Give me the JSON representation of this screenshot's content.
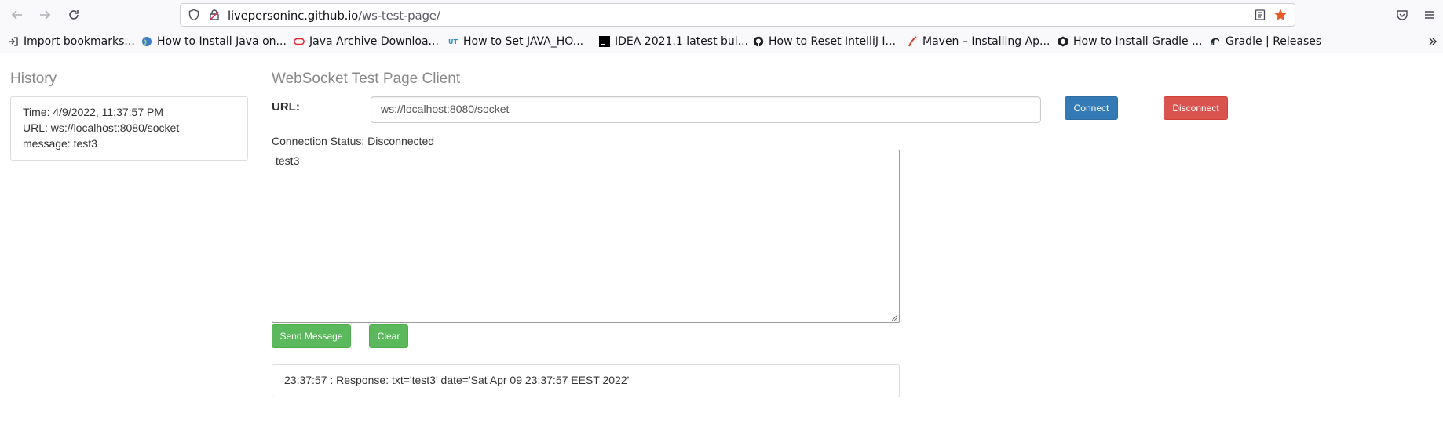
{
  "browser": {
    "url_host": "livepersoninc.github.io",
    "url_path": "/ws-test-page/",
    "bookmarks": [
      {
        "label": "Import bookmarks...",
        "icon": "import-icon"
      },
      {
        "label": "How to Install Java on...",
        "icon": "globe-icon"
      },
      {
        "label": "Java Archive Downloa...",
        "icon": "oracle-icon"
      },
      {
        "label": "How to Set JAVA_HO...",
        "icon": "ut-icon"
      },
      {
        "label": "IDEA 2021.1 latest bui...",
        "icon": "jetbrains-icon"
      },
      {
        "label": "How to Reset IntelliJ I...",
        "icon": "github-icon"
      },
      {
        "label": "Maven – Installing Ap...",
        "icon": "feather-icon"
      },
      {
        "label": "How to Install Gradle ...",
        "icon": "hexagon-icon"
      },
      {
        "label": "Gradle | Releases",
        "icon": "elephant-icon"
      }
    ]
  },
  "history": {
    "title": "History",
    "entry": {
      "time": "Time: 4/9/2022, 11:37:57 PM",
      "url": "URL: ws://localhost:8080/socket",
      "message": "message: test3"
    }
  },
  "client": {
    "title": "WebSocket Test Page Client",
    "url_label": "URL:",
    "url_value": "ws://localhost:8080/socket",
    "connect_label": "Connect",
    "disconnect_label": "Disconnect",
    "status_text": "Connection Status: Disconnected",
    "message_value": "test3",
    "send_label": "Send Message",
    "clear_label": "Clear",
    "response": "23:37:57 : Response: txt='test3' date='Sat Apr 09 23:37:57 EEST 2022'"
  },
  "colors": {
    "primary": "#337ab7",
    "danger": "#d9534f",
    "success": "#5cb85c"
  }
}
